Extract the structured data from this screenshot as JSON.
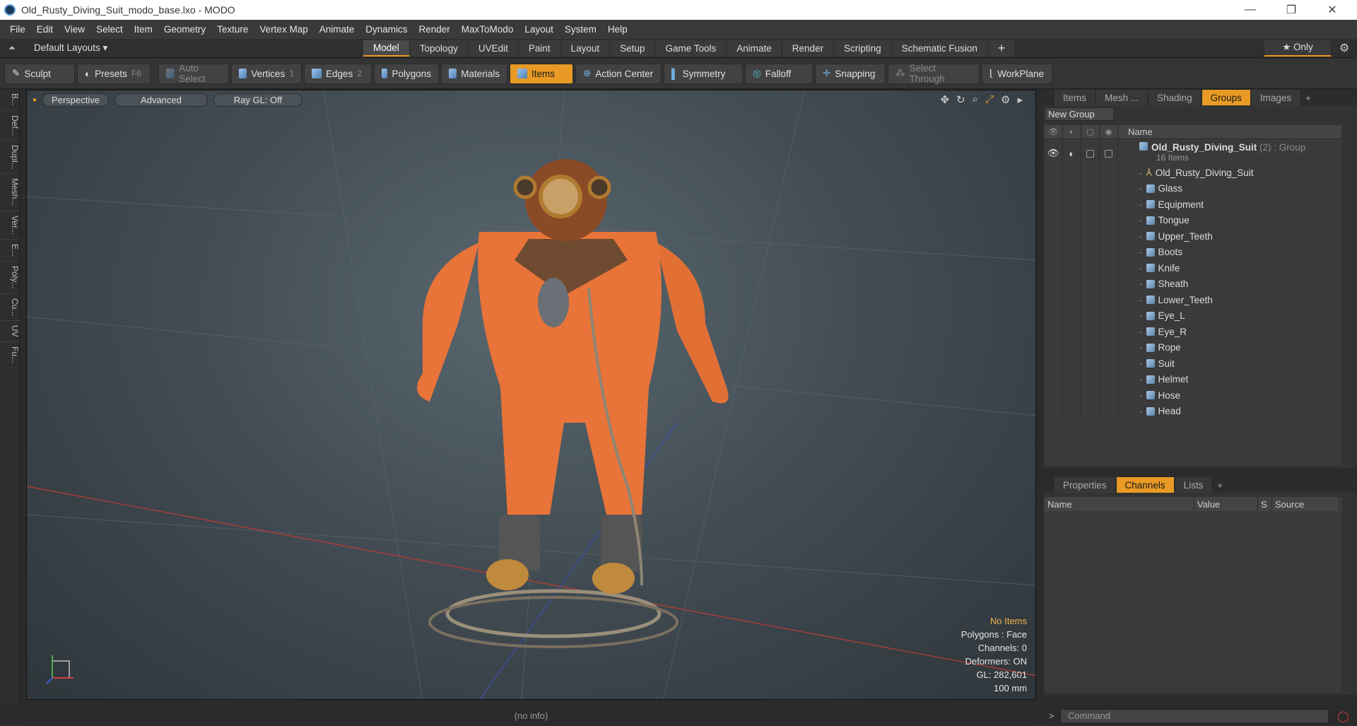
{
  "window": {
    "title": "Old_Rusty_Diving_Suit_modo_base.lxo - MODO",
    "min": "—",
    "max": "❐",
    "close": "✕"
  },
  "menu": [
    "File",
    "Edit",
    "View",
    "Select",
    "Item",
    "Geometry",
    "Texture",
    "Vertex Map",
    "Animate",
    "Dynamics",
    "Render",
    "MaxToModo",
    "Layout",
    "System",
    "Help"
  ],
  "layoutbar": {
    "layouts_label": "Default Layouts ▾",
    "tabs": [
      "Model",
      "Topology",
      "UVEdit",
      "Paint",
      "Layout",
      "Setup",
      "Game Tools",
      "Animate",
      "Render",
      "Scripting",
      "Schematic Fusion"
    ],
    "active_tab": "Model",
    "only_label": "★ Only"
  },
  "toolbar": {
    "sculpt": "Sculpt",
    "presets": "Presets",
    "presets_sc": "F6",
    "auto_select": "Auto Select",
    "vertices": "Vertices",
    "vertices_sc": "1",
    "edges": "Edges",
    "edges_sc": "2",
    "polygons": "Polygons",
    "materials": "Materials",
    "items": "Items",
    "action_center": "Action Center",
    "symmetry": "Symmetry",
    "falloff": "Falloff",
    "snapping": "Snapping",
    "select_through": "Select Through",
    "workplane": "WorkPlane"
  },
  "lefttabs": [
    "B...",
    "Def...",
    "Dupl...",
    "Mesh...",
    "Ver...",
    "E...",
    "Poly...",
    "Cu...",
    "UV",
    "Fu..."
  ],
  "viewport": {
    "perspective": "Perspective",
    "advanced": "Advanced",
    "raygl": "Ray GL: Off",
    "stats": {
      "no_items": "No Items",
      "polygons": "Polygons : Face",
      "channels": "Channels: 0",
      "deformers": "Deformers: ON",
      "gl": "GL: 282,601",
      "size": "100 mm"
    }
  },
  "status": "(no info)",
  "right_panel": {
    "tabs": [
      "Items",
      "Mesh ...",
      "Shading",
      "Groups",
      "Images"
    ],
    "active_tab": "Groups",
    "new_group": "New Group",
    "header_name": "Name",
    "group": {
      "name": "Old_Rusty_Diving_Suit",
      "suffix": "(2) : Group",
      "count": "16 Items"
    },
    "locator": "Old_Rusty_Diving_Suit",
    "meshes": [
      "Glass",
      "Equipment",
      "Tongue",
      "Upper_Teeth",
      "Boots",
      "Knife",
      "Sheath",
      "Lower_Teeth",
      "Eye_L",
      "Eye_R",
      "Rope",
      "Suit",
      "Helmet",
      "Hose",
      "Head"
    ]
  },
  "bottom_panel": {
    "tabs": [
      "Properties",
      "Channels",
      "Lists"
    ],
    "active_tab": "Channels",
    "columns": [
      "Name",
      "Value",
      "S",
      "Source"
    ]
  },
  "command": {
    "prompt": ">",
    "placeholder": "Command"
  },
  "colors": {
    "accent": "#e89a25",
    "suit": "#e8743a",
    "brass": "#c08a3c"
  }
}
